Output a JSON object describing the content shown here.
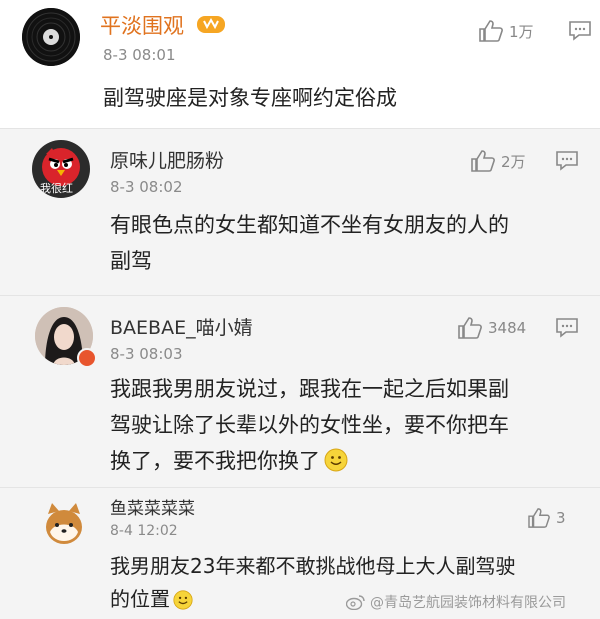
{
  "comments": [
    {
      "username": "平淡围观",
      "timestamp": "8-3 08:01",
      "likes": "1万",
      "text": "副驾驶座是对象专座啊约定俗成",
      "username_color": "#e0731f"
    },
    {
      "username": "原味儿肥肠粉",
      "avatar_text": "我很红",
      "timestamp": "8-3 08:02",
      "likes": "2万",
      "text_lines": [
        "有眼色点的女生都知道不坐有女朋友的人的",
        "副驾"
      ]
    },
    {
      "username": "BAEBAE_喵小婧",
      "timestamp": "8-3 08:03",
      "likes": "3484",
      "text_lines": [
        "我跟我男朋友说过，跟我在一起之后如果副",
        "驾驶让除了长辈以外的女性坐，要不你把车",
        "换了，要不我把你换了"
      ]
    },
    {
      "username": "鱼菜菜菜菜",
      "timestamp": "8-4 12:02",
      "likes": "3",
      "text_lines": [
        "我男朋友23年来都不敢挑战他母上大人副驾驶",
        "的位置"
      ]
    }
  ],
  "watermark": "@青岛艺航园装饰材料有限公司",
  "colors": {
    "accent_orange": "#e0731f",
    "reply_background": "#f4f4f4",
    "meta_gray": "#8a8a8a"
  }
}
